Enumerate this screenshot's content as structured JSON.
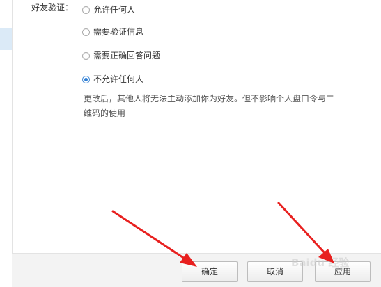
{
  "friend_verification": {
    "label": "好友验证：",
    "options": [
      {
        "label": "允许任何人",
        "selected": false
      },
      {
        "label": "需要验证信息",
        "selected": false
      },
      {
        "label": "需要正确回答问题",
        "selected": false
      },
      {
        "label": "不允许任何人",
        "selected": true
      }
    ],
    "description": "更改后，其他人将无法主动添加你为好友。但不影响个人盘口令与二维码的使用"
  },
  "footer": {
    "ok_label": "确定",
    "cancel_label": "取消",
    "apply_label": "应用"
  },
  "watermark": {
    "text": "Baidu 经验"
  },
  "colors": {
    "arrow": "#e8201f",
    "radio_selected": "#2f7fd5",
    "footer_bg": "#f3f3f3",
    "sidebar_active": "#dbeaf7"
  },
  "icons": {
    "annotation_arrows": "red-arrow-icon"
  }
}
